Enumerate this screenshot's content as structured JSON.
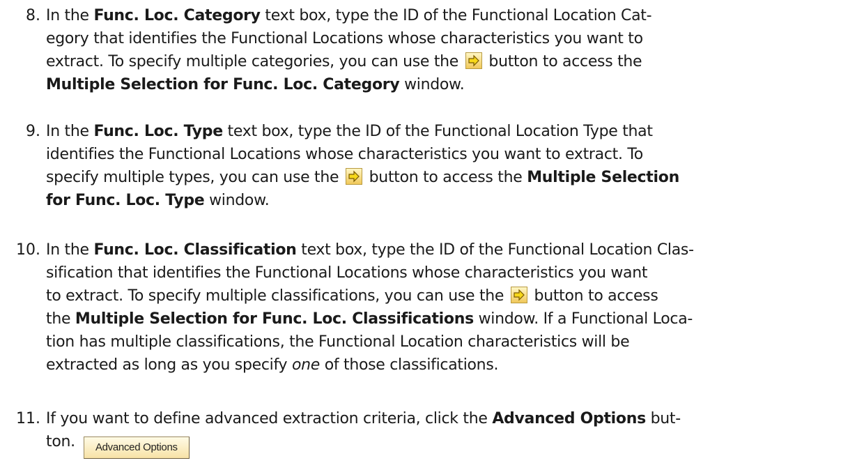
{
  "steps": [
    {
      "number": "8.",
      "lines": [
        [
          "In the ",
          {
            "b": "Func. Loc. Category"
          },
          " text box, type the ID of the Functional Location Cat-"
        ],
        [
          "egory that identifies the Functional Locations whose characteristics you want to"
        ],
        [
          "extract. To specify multiple categories, you can use the ",
          {
            "icon": "multiple-selection-arrow-icon"
          },
          " button to access the"
        ],
        [
          {
            "b": "Multiple Selection for Func. Loc. Category"
          },
          " window."
        ]
      ]
    },
    {
      "number": "9.",
      "lines": [
        [
          "In the ",
          {
            "b": "Func. Loc. Type"
          },
          " text box, type the ID of the Functional Location Type that"
        ],
        [
          "identifies the Functional Locations whose characteristics you want to extract. To"
        ],
        [
          "specify multiple types, you can use the ",
          {
            "icon": "multiple-selection-arrow-icon"
          },
          " button to access the ",
          {
            "b": "Multiple Selection"
          }
        ],
        [
          {
            "b": "for Func. Loc. Type"
          },
          " window."
        ]
      ]
    },
    {
      "number": "10.",
      "lines": [
        [
          "In the ",
          {
            "b": "Func. Loc. Classification"
          },
          " text box, type the ID of the Functional Location Clas-"
        ],
        [
          "sification that identifies the Functional Locations whose characteristics you want"
        ],
        [
          "to extract. To specify multiple classifications, you can use the ",
          {
            "icon": "multiple-selection-arrow-icon"
          },
          " button to access"
        ],
        [
          "the ",
          {
            "b": "Multiple Selection for Func. Loc. Classifications"
          },
          " window. If a Functional Loca-"
        ],
        [
          "tion has multiple classifications, the Functional Location characteristics will be"
        ],
        [
          "extracted as long as you specify ",
          {
            "i": "one"
          },
          " of those classifications."
        ]
      ]
    },
    {
      "number": "11.",
      "lines": [
        [
          "If you want to define advanced extraction criteria, click the ",
          {
            "b": "Advanced Options"
          },
          " but-"
        ],
        [
          "ton.",
          {
            "button": "Advanced Options"
          }
        ]
      ]
    }
  ],
  "colors": {
    "text": "#1a1a1a",
    "icon_fill": "#f0c85a",
    "arrow": "#e8c000"
  }
}
